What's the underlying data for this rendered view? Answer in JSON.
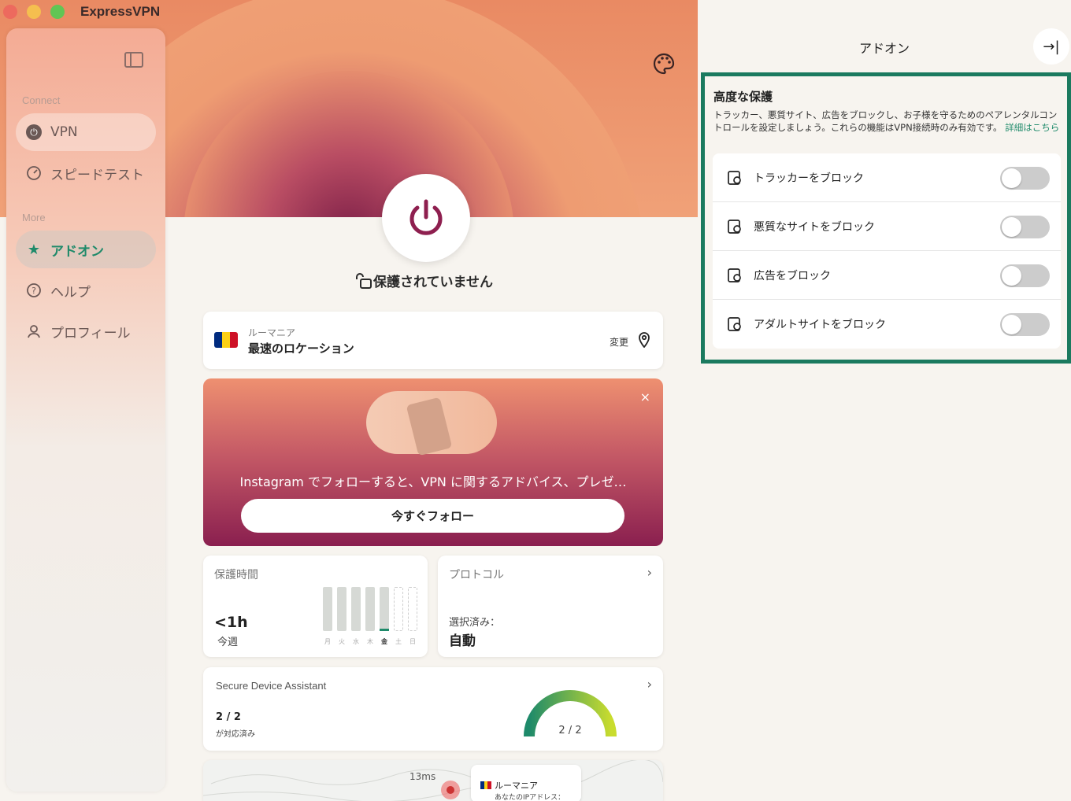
{
  "window": {
    "app_name": "ExpressVPN"
  },
  "sidebar": {
    "section_connect": "Connect",
    "section_more": "More",
    "items": [
      {
        "label": "VPN"
      },
      {
        "label": "スピードテスト"
      },
      {
        "label": "アドオン"
      },
      {
        "label": "ヘルプ"
      },
      {
        "label": "プロフィール"
      }
    ]
  },
  "main": {
    "status": "保護されていません",
    "location": {
      "country": "ルーマニア",
      "name": "最速のロケーション",
      "change": "変更"
    },
    "promo": {
      "text": "Instagram でフォローすると、VPN に関するアドバイス、プレゼ…",
      "button": "今すぐフォロー",
      "close": "×"
    },
    "protection_time": {
      "title": "保護時間",
      "value": "<1h",
      "period": "今週",
      "days": [
        "月",
        "火",
        "水",
        "木",
        "金",
        "土",
        "日"
      ]
    },
    "protocol": {
      "title": "プロトコル",
      "selected_label": "選択済み：",
      "value": "自動"
    },
    "secure_device": {
      "title": "Secure Device Assistant",
      "count": "2 / 2",
      "sub": "が対応済み",
      "gauge": "2 / 2",
      "progress": 1.0
    },
    "map": {
      "latency": "13ms",
      "country": "ルーマニア",
      "ip_label": "あなたのIPアドレス："
    }
  },
  "panel": {
    "title": "アドオン",
    "close_icon": "→|",
    "advanced": {
      "title": "高度な保護",
      "description": "トラッカー、悪質サイト、広告をブロックし、お子様を守るためのペアレンタルコントロールを設定しましょう。これらの機能はVPN接続時のみ有効です。",
      "link": "詳細はこちら",
      "toggles": [
        {
          "label": "トラッカーをブロック",
          "on": false
        },
        {
          "label": "悪質なサイトをブロック",
          "on": false
        },
        {
          "label": "広告をブロック",
          "on": false
        },
        {
          "label": "アダルトサイトをブロック",
          "on": false
        }
      ]
    }
  },
  "colors": {
    "accent": "#1e8a6a",
    "highlight_border": "#1b7a5f",
    "power": "#8e1f4f"
  }
}
